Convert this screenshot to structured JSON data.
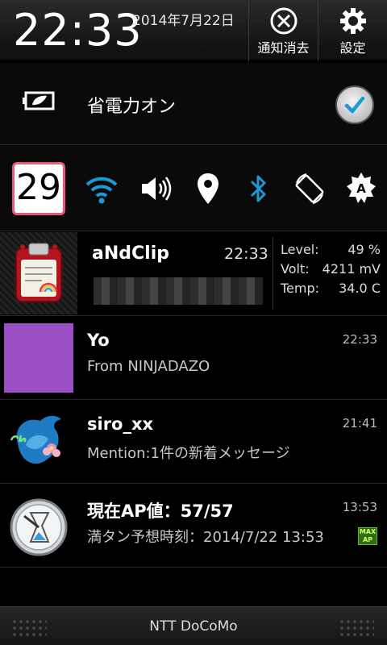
{
  "status_header": {
    "clock": "22:33",
    "date": "2014年7月22日",
    "clear_label": "通知消去",
    "settings_label": "設定"
  },
  "power_saver": {
    "label": "省電力オン",
    "checked": true
  },
  "quick_settings": {
    "day_number": "29",
    "icons": [
      "wifi-icon",
      "volume-icon",
      "location-icon",
      "bluetooth-icon",
      "auto-rotate-icon",
      "auto-brightness-icon"
    ],
    "auto_brightness_letter": "A"
  },
  "notifications": [
    {
      "app": "aNdClip",
      "time": "22:33",
      "stats": [
        {
          "label": "Level:",
          "value": "49 %"
        },
        {
          "label": "Volt:",
          "value": "4211 mV"
        },
        {
          "label": "Temp:",
          "value": "34.0 C"
        }
      ]
    },
    {
      "title": "Yo",
      "subtitle": "From NINJADAZO",
      "time": "22:33"
    },
    {
      "title": "siro_xx",
      "subtitle": "Mention:1件の新着メッセージ",
      "time": "21:41"
    },
    {
      "title": "現在AP値：57/57",
      "subtitle": "満タン予想時刻：2014/7/22 13:53",
      "time": "13:53",
      "badge": "MAX AP"
    }
  ],
  "footer": {
    "carrier": "NTT DoCoMo"
  },
  "colors": {
    "accent_blue": "#1a9ad6",
    "day_border": "#e8597a",
    "yo_purple": "#9b4fc4"
  }
}
